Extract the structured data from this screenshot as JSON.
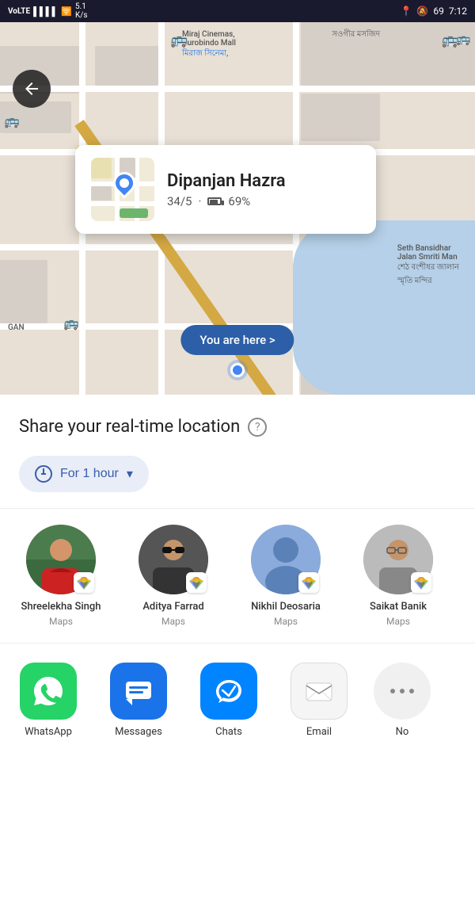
{
  "statusBar": {
    "carrier": "VoLTE 4G",
    "signal": "5.1 K/s",
    "battery": "69",
    "time": "7:12"
  },
  "map": {
    "backLabel": "←",
    "infoCard": {
      "name": "Dipanjan Hazra",
      "rating": "34/5",
      "battery": "69%"
    },
    "youAreHere": "You are here >"
  },
  "share": {
    "title": "Share your real-time location",
    "helpSymbol": "?",
    "durationLabel": "For 1 hour",
    "dropdownSymbol": "▾"
  },
  "contacts": [
    {
      "name": "Shreelekha Singh",
      "app": "Maps",
      "avatarClass": "avatar-1"
    },
    {
      "name": "Aditya Farrad",
      "app": "Maps",
      "avatarClass": "avatar-2"
    },
    {
      "name": "Nikhil Deosaria",
      "app": "Maps",
      "avatarClass": "avatar-3"
    },
    {
      "name": "Saikat Banik",
      "app": "Maps",
      "avatarClass": "avatar-4"
    }
  ],
  "apps": [
    {
      "name": "WhatsApp",
      "iconClass": "app-icon-whatsapp",
      "symbol": "whatsapp"
    },
    {
      "name": "Messages",
      "iconClass": "app-icon-messages",
      "symbol": "messages"
    },
    {
      "name": "Chats",
      "iconClass": "app-icon-chats",
      "symbol": "chats"
    },
    {
      "name": "Email",
      "iconClass": "app-icon-email",
      "symbol": "email"
    },
    {
      "name": "No",
      "iconClass": "app-icon-more",
      "symbol": "more"
    }
  ]
}
